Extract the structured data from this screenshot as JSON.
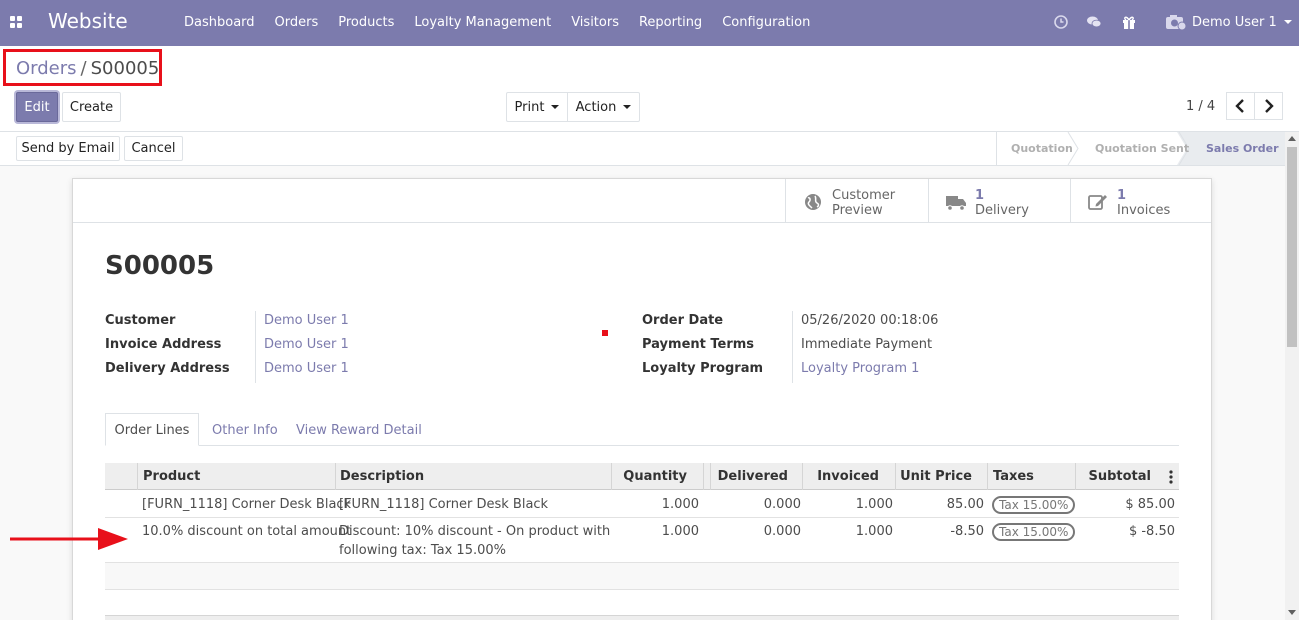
{
  "navbar": {
    "brand": "Website",
    "menu": [
      "Dashboard",
      "Orders",
      "Products",
      "Loyalty Management",
      "Visitors",
      "Reporting",
      "Configuration"
    ],
    "user": "Demo User 1",
    "color": "#7c7bad"
  },
  "control": {
    "breadcrumb_parent": "Orders",
    "breadcrumb_sep": "/",
    "breadcrumb_current": "S00005",
    "edit_label": "Edit",
    "create_label": "Create",
    "print_label": "Print",
    "action_label": "Action",
    "pager": "1 / 4"
  },
  "statusbar": {
    "send_email_label": "Send by Email",
    "cancel_label": "Cancel",
    "stages": [
      "Quotation",
      "Quotation Sent",
      "Sales Order"
    ],
    "active_stage": "Sales Order"
  },
  "smart_buttons": {
    "customer_preview_l1": "Customer",
    "customer_preview_l2": "Preview",
    "delivery_count": "1",
    "delivery_label": "Delivery",
    "invoices_count": "1",
    "invoices_label": "Invoices"
  },
  "order": {
    "name": "S00005",
    "customer_label": "Customer",
    "customer": "Demo User 1",
    "invoice_address_label": "Invoice Address",
    "invoice_address": "Demo User 1",
    "delivery_address_label": "Delivery Address",
    "delivery_address": "Demo User 1",
    "order_date_label": "Order Date",
    "order_date": "05/26/2020 00:18:06",
    "payment_terms_label": "Payment Terms",
    "payment_terms": "Immediate Payment",
    "loyalty_program_label": "Loyalty Program",
    "loyalty_program": "Loyalty Program 1"
  },
  "tabs": [
    "Order Lines",
    "Other Info",
    "View Reward Detail"
  ],
  "table": {
    "headers": [
      "Product",
      "Description",
      "Quantity",
      "Delivered",
      "Invoiced",
      "Unit Price",
      "Taxes",
      "Subtotal"
    ],
    "rows": [
      {
        "product": "[FURN_1118] Corner Desk Black",
        "description_l1": "[FURN_1118] Corner Desk Black",
        "description_l2": "",
        "quantity": "1.000",
        "delivered": "0.000",
        "invoiced": "1.000",
        "unit_price": "85.00",
        "taxes": "Tax 15.00%",
        "subtotal": "$ 85.00"
      },
      {
        "product": "10.0% discount on total amount",
        "description_l1": "Discount: 10% discount - On product with",
        "description_l2": "following tax: Tax 15.00%",
        "quantity": "1.000",
        "delivered": "0.000",
        "invoiced": "1.000",
        "unit_price": "-8.50",
        "taxes": "Tax 15.00%",
        "subtotal": "$ -8.50"
      }
    ]
  },
  "annotation_colors": {
    "highlight": "#e8101a"
  }
}
